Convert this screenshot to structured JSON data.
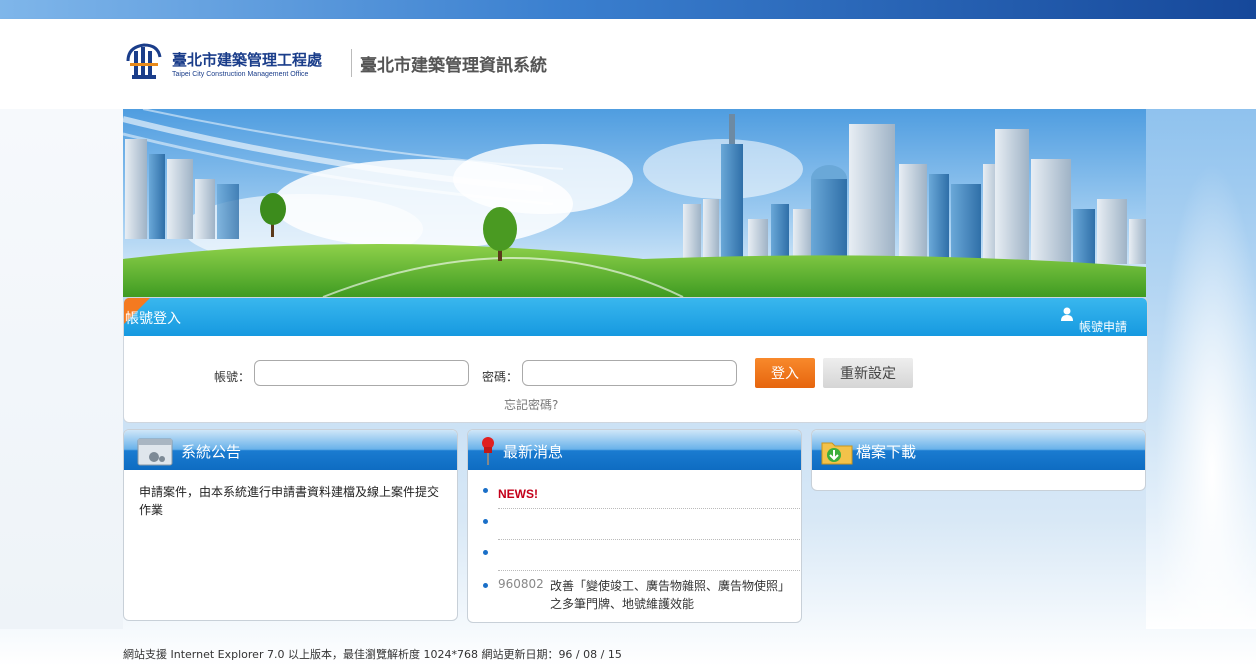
{
  "header": {
    "org_name": "臺北市建築管理工程處",
    "org_name_en": "Taipei City Construction Management Office",
    "system_title": "臺北市建築管理資訊系統"
  },
  "login": {
    "title": "帳號登入",
    "apply_link": "帳號申請",
    "account_label": "帳號：",
    "account_value": "",
    "password_label": "密碼：",
    "password_value": "",
    "login_button": "登入",
    "reset_button": "重新設定",
    "forgot_link": "忘記密碼?"
  },
  "panels": {
    "notice": {
      "title": "系統公告",
      "text": "申請案件，由本系統進行申請書資料建檔及線上案件提交作業"
    },
    "news": {
      "title": "最新消息",
      "items": [
        {
          "badge": "NEWS!"
        },
        {
          "text": ""
        },
        {
          "text": ""
        },
        {
          "date": "960802",
          "text": "改善「變使竣工、廣告物雜照、廣告物使照」之多筆門牌、地號維護效能"
        }
      ]
    },
    "downloads": {
      "title": "檔案下載"
    }
  },
  "footer": {
    "text": "網站支援 Internet Explorer 7.0 以上版本，最佳瀏覽解析度 1024*768 網站更新日期：96 / 08 / 15"
  },
  "colors": {
    "accent_blue": "#1699e0",
    "login_orange": "#f47a20",
    "news_red": "#c4001a"
  }
}
